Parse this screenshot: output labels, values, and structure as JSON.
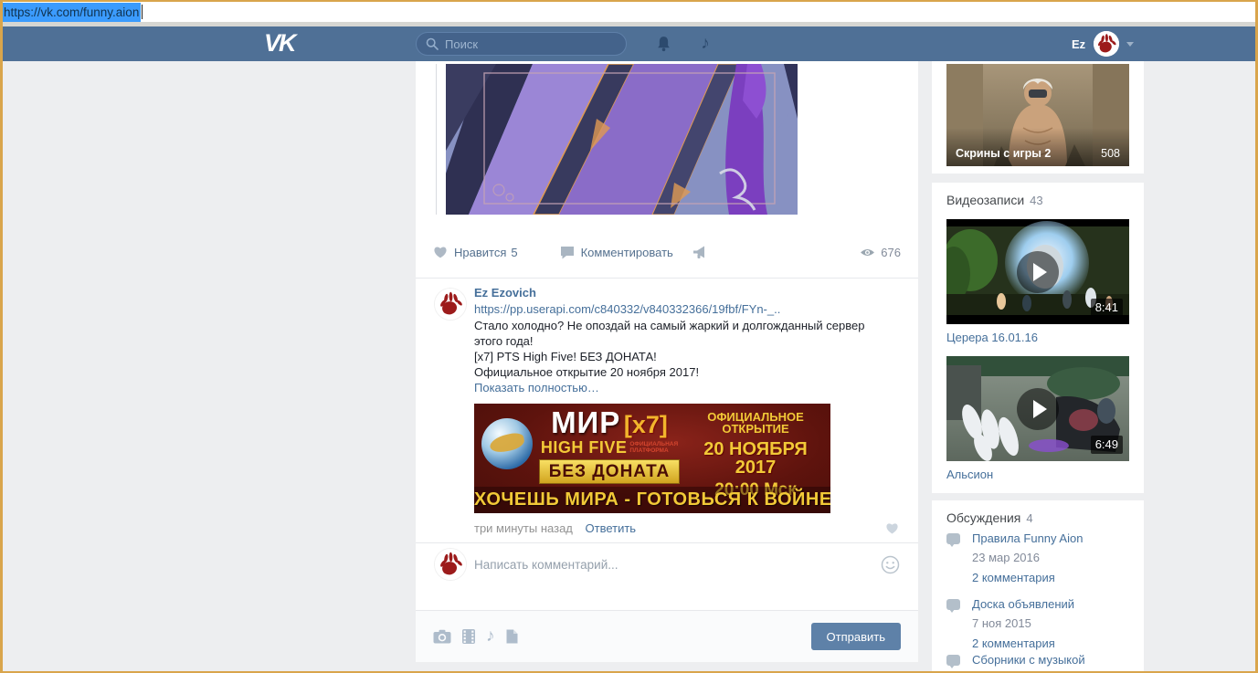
{
  "browser": {
    "url_selected": "https://vk.com/funny.aion"
  },
  "header": {
    "logo": "VK",
    "search_placeholder": "Поиск",
    "user_short_name": "Ez"
  },
  "post": {
    "like_label": "Нравится",
    "like_count": "5",
    "comment_label": "Комментировать",
    "views_count": "676"
  },
  "comment": {
    "author": "Ez Ezovich",
    "attachment_link": "https://pp.userapi.com/c840332/v840332366/19fbf/FYn-_..",
    "text": "Стало холодно? Не опоздай на самый жаркий и долгожданный сервер этого года!\n[x7] PTS High Five! БЕЗ ДОНАТА!\nОфициальное открытие 20 ноября 2017!",
    "show_more_label": "Показать полностью…",
    "time": "три минуты назад",
    "reply_label": "Ответить",
    "banner": {
      "world": "МИР",
      "rate": "[x7]",
      "platform_title": "HIGH FIVE",
      "platform_note_1": "ОФИЦИАЛЬНАЯ",
      "platform_note_2": "ПЛАТФОРМА",
      "no_donate": "БЕЗ ДОНАТА",
      "opening_label": "ОФИЦИАЛЬНОЕ ОТКРЫТИЕ",
      "opening_date": "20 НОЯБРЯ 2017",
      "opening_time": "20:00 Мск",
      "slogan": "ХОЧЕШЬ МИРА - ГОТОВЬСЯ К ВОЙНЕ"
    }
  },
  "comment_form": {
    "placeholder": "Написать комментарий...",
    "submit_label": "Отправить"
  },
  "sidebar": {
    "album": {
      "title": "Скрины с игры 2",
      "count": "508"
    },
    "videos": {
      "title": "Видеозаписи",
      "count": "43",
      "items": [
        {
          "title": "Церера 16.01.16",
          "duration": "8:41"
        },
        {
          "title": "Альсион",
          "duration": "6:49"
        }
      ]
    },
    "discussions": {
      "title": "Обсуждения",
      "count": "4",
      "items": [
        {
          "title": "Правила Funny Aion",
          "date": "23 мар 2016",
          "comments": "2 комментария"
        },
        {
          "title": "Доска объявлений",
          "date": "7 ноя 2015",
          "comments": "2 комментария"
        },
        {
          "title": "Сборники с музыкой"
        }
      ]
    }
  },
  "colors": {
    "header_bar": "#4f7096",
    "link": "#456f9a",
    "send_button": "#5e81a8",
    "window_frame": "#d9a54c",
    "url_selection": "#3b9bfd"
  }
}
